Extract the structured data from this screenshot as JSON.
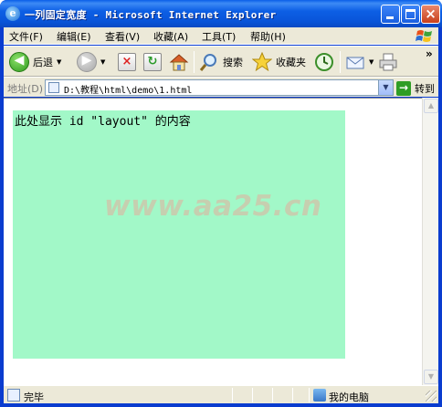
{
  "window": {
    "title": "一列固定宽度 - Microsoft Internet Explorer",
    "app_icon_glyph": "e"
  },
  "menubar": {
    "items": [
      "文件(F)",
      "编辑(E)",
      "查看(V)",
      "收藏(A)",
      "工具(T)",
      "帮助(H)"
    ]
  },
  "toolbar": {
    "back_label": "后退",
    "search_label": "搜索",
    "favorites_label": "收藏夹",
    "overflow_glyph": "»"
  },
  "addressbar": {
    "label": "地址(D)",
    "value": "D:\\教程\\html\\demo\\1.html",
    "go_label": "转到"
  },
  "content": {
    "layout_text": "此处显示 id \"layout\" 的内容",
    "watermark": "www.aa25.cn",
    "box_color": "#a2f8c8"
  },
  "statusbar": {
    "status_text": "完毕",
    "zone_text": "我的电脑"
  },
  "colors": {
    "titlebar": "#0954d8",
    "chrome": "#ece9d8"
  }
}
